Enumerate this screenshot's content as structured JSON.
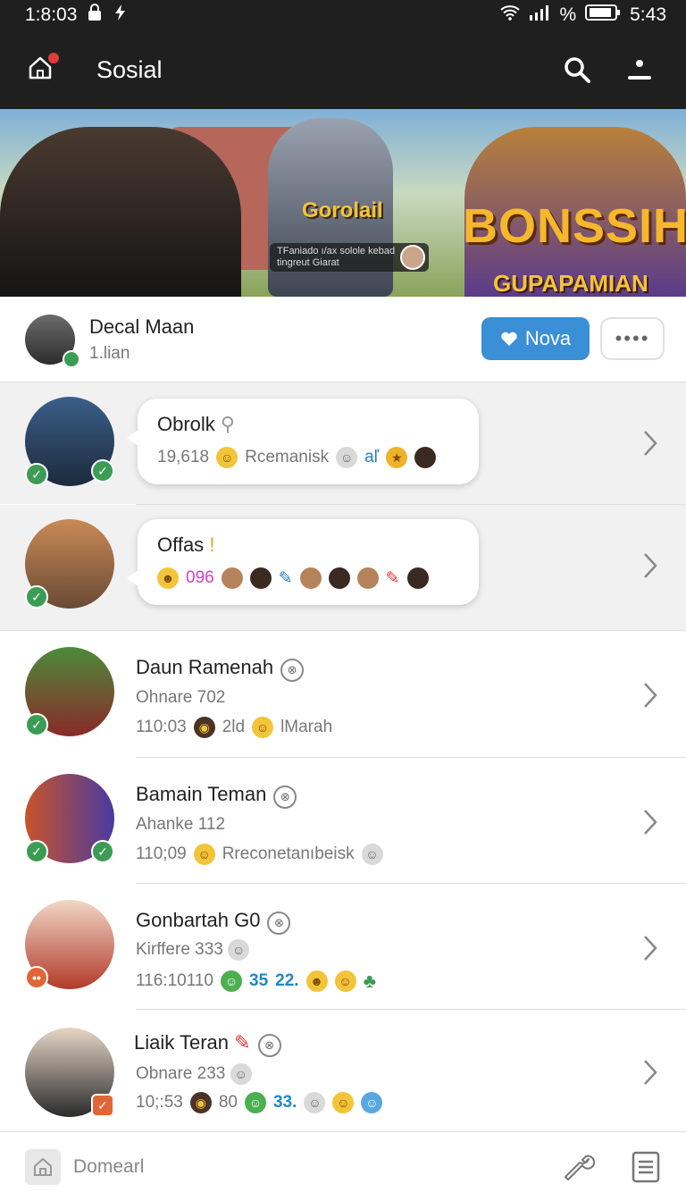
{
  "status_bar": {
    "left_time": "1:8:03",
    "battery_text": "%",
    "time": "5:43"
  },
  "app_bar": {
    "title": "Sosial"
  },
  "banner": {
    "game_title": "Gorolail",
    "caption": "TFaniado ı/ax solole kebad tingreut Giarat",
    "big_title": "BONSSIH",
    "big_subtitle": "GUPAPAMIAN"
  },
  "profile": {
    "name": "Decal Maan",
    "sub": "1.lian",
    "nova_label": "Nova",
    "more_label": "••••"
  },
  "chats": [
    {
      "title": "Obrolk",
      "count": "19,618",
      "text": "Rcemanisk",
      "extra": "aľ"
    },
    {
      "title": "Offas",
      "count": "096"
    }
  ],
  "contacts": [
    {
      "name": "Daun Ramenah",
      "sub": "Ohnare 702",
      "time": "110:03",
      "extra": "2ld",
      "text": "lMarah"
    },
    {
      "name": "Bamain Teman",
      "sub": "Ahanke 112",
      "time": "110;09",
      "text": "Rreconetanıbeisk"
    },
    {
      "name": "Gonbartah G0",
      "sub": "Kirffere 333",
      "time": "116:10110",
      "n1": "35",
      "n2": "22."
    },
    {
      "name": "Liaik Teran",
      "sub": "Obnare 233",
      "time": "10;:53",
      "n1": "80",
      "n2": "33."
    }
  ],
  "bottom_bar": {
    "label": "Domearl"
  },
  "colors": {
    "accent": "#3a8fd6",
    "online": "#3c9c55",
    "app_bar": "#1f1f1f"
  }
}
